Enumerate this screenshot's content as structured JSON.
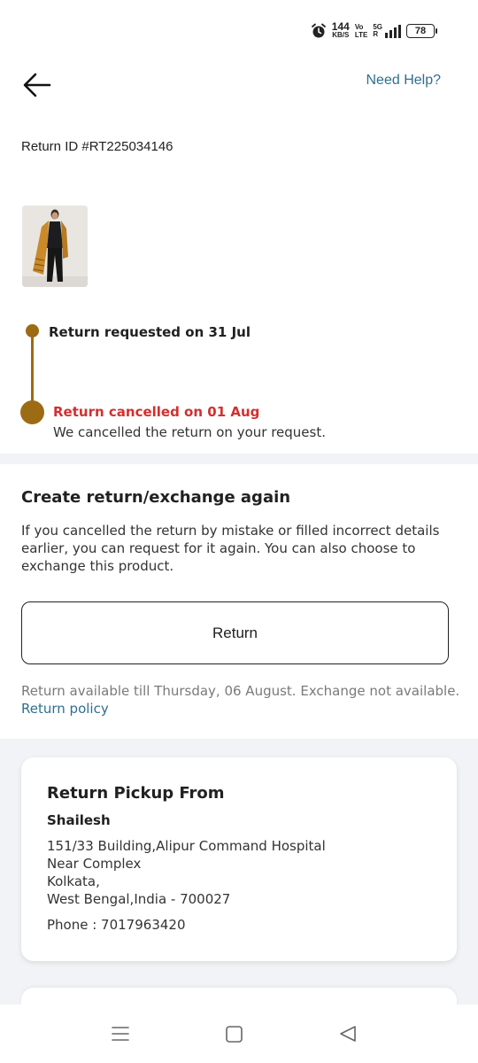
{
  "status_bar": {
    "net_speed_value": "144",
    "net_speed_unit": "KB/S",
    "volte_top": "Vo",
    "volte_bottom": "LTE",
    "signal_top": "5G",
    "signal_bottom": "R",
    "battery": "78",
    "icons": [
      "alarm-icon",
      "signal-icon",
      "battery-icon"
    ]
  },
  "header": {
    "back_icon": "arrow-left-icon",
    "need_help": "Need Help?"
  },
  "return_id": "Return ID #RT225034146",
  "timeline": {
    "accent_color": "#9c6b14",
    "steps": [
      {
        "label": "Return requested on 31 Jul"
      },
      {
        "label": "Return cancelled on 01 Aug",
        "sub": "We cancelled the return on your request.",
        "color": "#d32f2f"
      }
    ]
  },
  "create_again": {
    "title": "Create return/exchange again",
    "description": "If you cancelled the return by mistake or filled incorrect details earlier, you can request for it again. You can also choose to exchange this product.",
    "button_label": "Return",
    "availability": "Return available till Thursday, 06 August. Exchange not available.",
    "policy_link": "Return policy"
  },
  "pickup": {
    "title": "Return Pickup From",
    "name": "Shailesh",
    "address_lines": [
      "151/33 Building,Alipur Command Hospital",
      "Near Complex",
      "Kolkata,",
      "West Bengal,India - 700027"
    ],
    "phone": "Phone : 7017963420"
  },
  "nav_bar": {
    "icons": [
      "menu-icon",
      "home-icon",
      "back-triangle-icon"
    ]
  }
}
